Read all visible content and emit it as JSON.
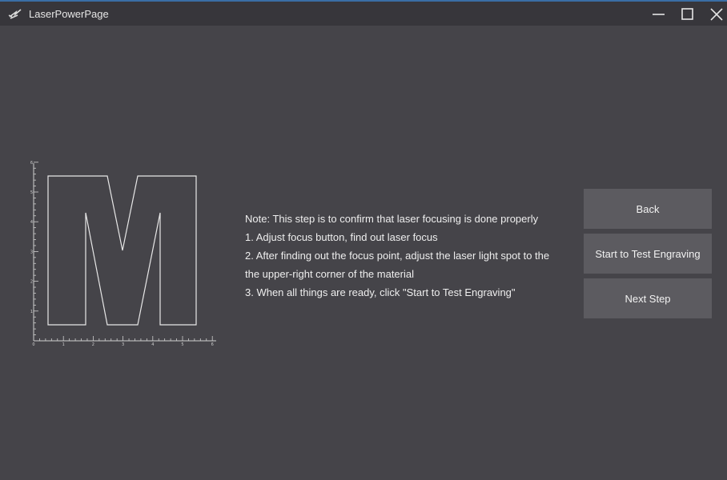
{
  "window": {
    "title": "LaserPowerPage",
    "icon": "laser-app-icon",
    "controls": {
      "minimize": "minimize-icon",
      "maximize": "maximize-icon",
      "close": "close-icon"
    }
  },
  "preview": {
    "letter_shape": "M",
    "x_ticks": [
      "0",
      "1",
      "2",
      "3",
      "4",
      "5",
      "6"
    ],
    "y_ticks": [
      "1",
      "2",
      "3",
      "4",
      "5",
      "6"
    ]
  },
  "note": {
    "lines": [
      "Note: This step is to confirm that laser focusing is done properly",
      "1. Adjust focus button, find out laser focus",
      "2. After finding out the focus point, adjust the laser light spot to the",
      "the upper-right corner of the material",
      "3. When all things are ready, click \"Start to Test Engraving\""
    ]
  },
  "buttons": {
    "back": "Back",
    "test_engraving": "Start to Test Engraving",
    "next_step": "Next Step"
  },
  "colors": {
    "background": "#454449",
    "titlebar": "#37363b",
    "button": "#5c5b60",
    "accent": "#3a6ea5"
  }
}
